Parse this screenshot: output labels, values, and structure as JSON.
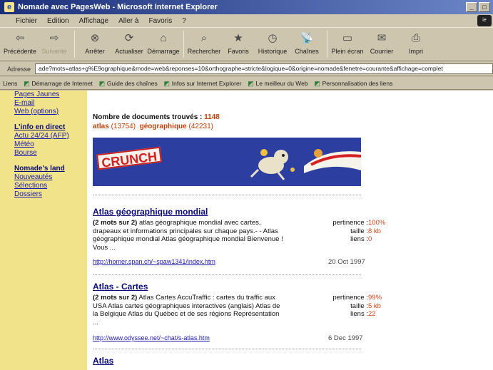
{
  "window": {
    "title": "Nomade avec PagesWeb - Microsoft Internet Explorer",
    "buttons": [
      "_",
      "□",
      "×"
    ]
  },
  "menu": [
    "Fichier",
    "Edition",
    "Affichage",
    "Aller à",
    "Favoris",
    "?"
  ],
  "toolbar": [
    {
      "label": "Précédente",
      "icon": "back-arrow-icon",
      "glyph": "⇦",
      "enabled": true
    },
    {
      "label": "Suivante",
      "icon": "forward-arrow-icon",
      "glyph": "⇨",
      "enabled": false
    },
    {
      "label": "Arrêter",
      "icon": "stop-icon",
      "glyph": "⊗",
      "enabled": true
    },
    {
      "label": "Actualiser",
      "icon": "refresh-icon",
      "glyph": "⟳",
      "enabled": true
    },
    {
      "label": "Démarrage",
      "icon": "home-icon",
      "glyph": "⌂",
      "enabled": true
    },
    {
      "label": "Rechercher",
      "icon": "search-icon",
      "glyph": "⌕",
      "enabled": true
    },
    {
      "label": "Favoris",
      "icon": "favorites-icon",
      "glyph": "★",
      "enabled": true
    },
    {
      "label": "Historique",
      "icon": "history-icon",
      "glyph": "◷",
      "enabled": true
    },
    {
      "label": "Chaînes",
      "icon": "channels-icon",
      "glyph": "📡",
      "enabled": true
    },
    {
      "label": "Plein écran",
      "icon": "fullscreen-icon",
      "glyph": "▭",
      "enabled": true
    },
    {
      "label": "Courrier",
      "icon": "mail-icon",
      "glyph": "✉",
      "enabled": true
    },
    {
      "label": "Impri",
      "icon": "print-icon",
      "glyph": "⎙",
      "enabled": true
    }
  ],
  "address": {
    "label": "Adresse",
    "value": "ade?mots=atlas+g%E9ographique&mode=web&reponses=10&orthographe=stricte&logique=0&origine=nomade&fenetre=courante&affichage=complet"
  },
  "links": {
    "label": "Liens",
    "items": [
      "Démarrage de Internet",
      "Guide des chaînes",
      "Infos sur Internet Explorer",
      "Le meilleur du Web",
      "Personnalisation des liens"
    ]
  },
  "sidebar": {
    "top_links": [
      "Pages Jaunes",
      "E-mail",
      "Web (options)"
    ],
    "sections": [
      {
        "heading": "L'info en direct",
        "items": [
          "Actu 24/24 (AFP)",
          "Météo",
          "Bourse"
        ]
      },
      {
        "heading": "Nomade's land",
        "items": [
          "Nouveautés",
          "Sélections",
          "Dossiers"
        ]
      }
    ]
  },
  "search": {
    "found_label": "Nombre de documents trouvés :",
    "found_count": "1148",
    "term1": "atlas",
    "term1_count": "(13754)",
    "term2": "géographique",
    "term2_count": "(42231)"
  },
  "banner": {
    "brand": "CRUNCH"
  },
  "results": [
    {
      "title": "Atlas géographique mondial",
      "match": "(2 mots sur 2)",
      "snippet": "atlas géographique mondial avec cartes, drapeaux et informations principales sur chaque pays.- - Atlas géographique mondial Atlas géographique mondial Bienvenue ! Vous ...",
      "url": "http://homer.span.ch/~spaw1341/index.htm",
      "pertinence_label": "pertinence :",
      "pertinence": "100%",
      "taille_label": "taille :",
      "taille": "8 kb",
      "liens_label": "liens :",
      "liens": "0",
      "date": "20 Oct 1997"
    },
    {
      "title": "Atlas - Cartes",
      "match": "(2 mots sur 2)",
      "snippet": "Atlas Cartes AccuTraffic : cartes du traffic aux USA Atlas cartes géographiques interactives (anglais) Atlas de la Belgique Atlas du Québec et de ses régions Représentation ...",
      "url": "http://www.odyssee.net/~chat/s-atlas.htm",
      "pertinence_label": "pertinence :",
      "pertinence": "99%",
      "taille_label": "taille :",
      "taille": "5 kb",
      "liens_label": "liens :",
      "liens": "22",
      "date": "6 Dec 1997"
    },
    {
      "title": "Atlas"
    }
  ]
}
